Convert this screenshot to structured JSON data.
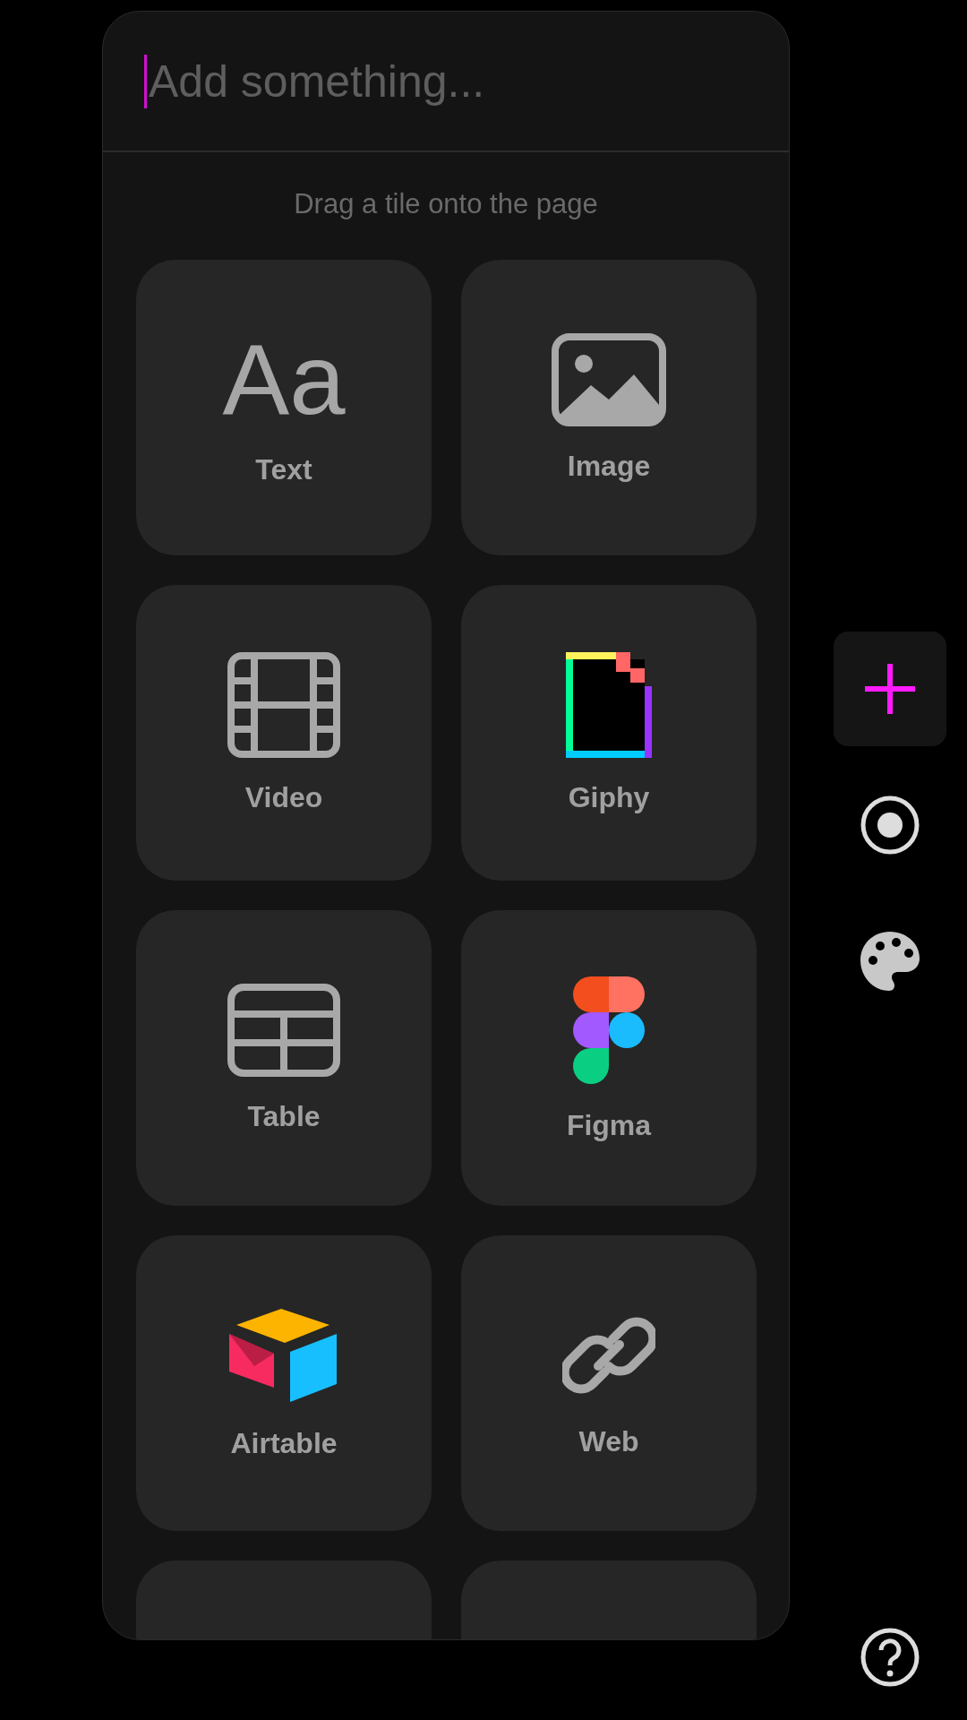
{
  "search": {
    "placeholder": "Add something..."
  },
  "hint": "Drag a tile onto the page",
  "tiles": [
    {
      "kind": "text",
      "glyph": "Aa",
      "label": "Text"
    },
    {
      "kind": "image",
      "label": "Image"
    },
    {
      "kind": "video",
      "label": "Video"
    },
    {
      "kind": "giphy",
      "label": "Giphy"
    },
    {
      "kind": "table",
      "label": "Table"
    },
    {
      "kind": "figma",
      "label": "Figma"
    },
    {
      "kind": "airtable",
      "label": "Airtable"
    },
    {
      "kind": "web",
      "label": "Web"
    }
  ],
  "toolbar": [
    {
      "kind": "add",
      "selected": true
    },
    {
      "kind": "record",
      "selected": false
    },
    {
      "kind": "palette",
      "selected": false
    }
  ]
}
